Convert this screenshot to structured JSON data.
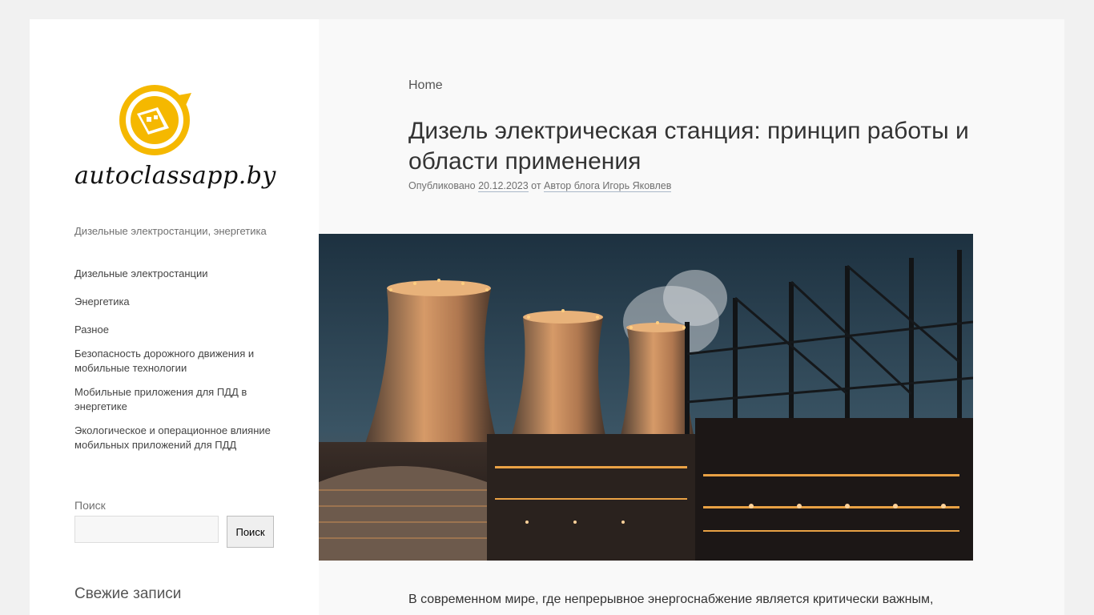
{
  "site": {
    "logo_text": "autoclassapp.by",
    "tagline": "Дизельные электростанции, энергетика"
  },
  "nav": {
    "items": [
      {
        "label": "Дизельные электростанции"
      },
      {
        "label": "Энергетика"
      },
      {
        "label": "Разное"
      },
      {
        "label": "Безопасность дорожного движения и мобильные технологии"
      },
      {
        "label": "Мобильные приложения для ПДД в энергетике"
      },
      {
        "label": "Экологическое и операционное влияние мобильных приложений для ПДД"
      }
    ]
  },
  "search": {
    "label": "Поиск",
    "value": "",
    "placeholder": "",
    "button_label": "Поиск"
  },
  "recent": {
    "title": "Свежие записи"
  },
  "post": {
    "breadcrumb": "Home",
    "title": "Дизель электрическая станция: принцип работы и области применения",
    "meta_prefix": "Опубликовано",
    "date": "20.12.2023",
    "meta_by": "от",
    "author": "Автор блога Игорь Яковлев",
    "intro": "В современном мире, где непрерывное энергоснабжение является критически важным,"
  },
  "colors": {
    "accent": "#f5b800",
    "page_bg": "#f1f1f1",
    "sidebar_bg": "#ffffff",
    "content_bg": "#f9f9f9"
  }
}
